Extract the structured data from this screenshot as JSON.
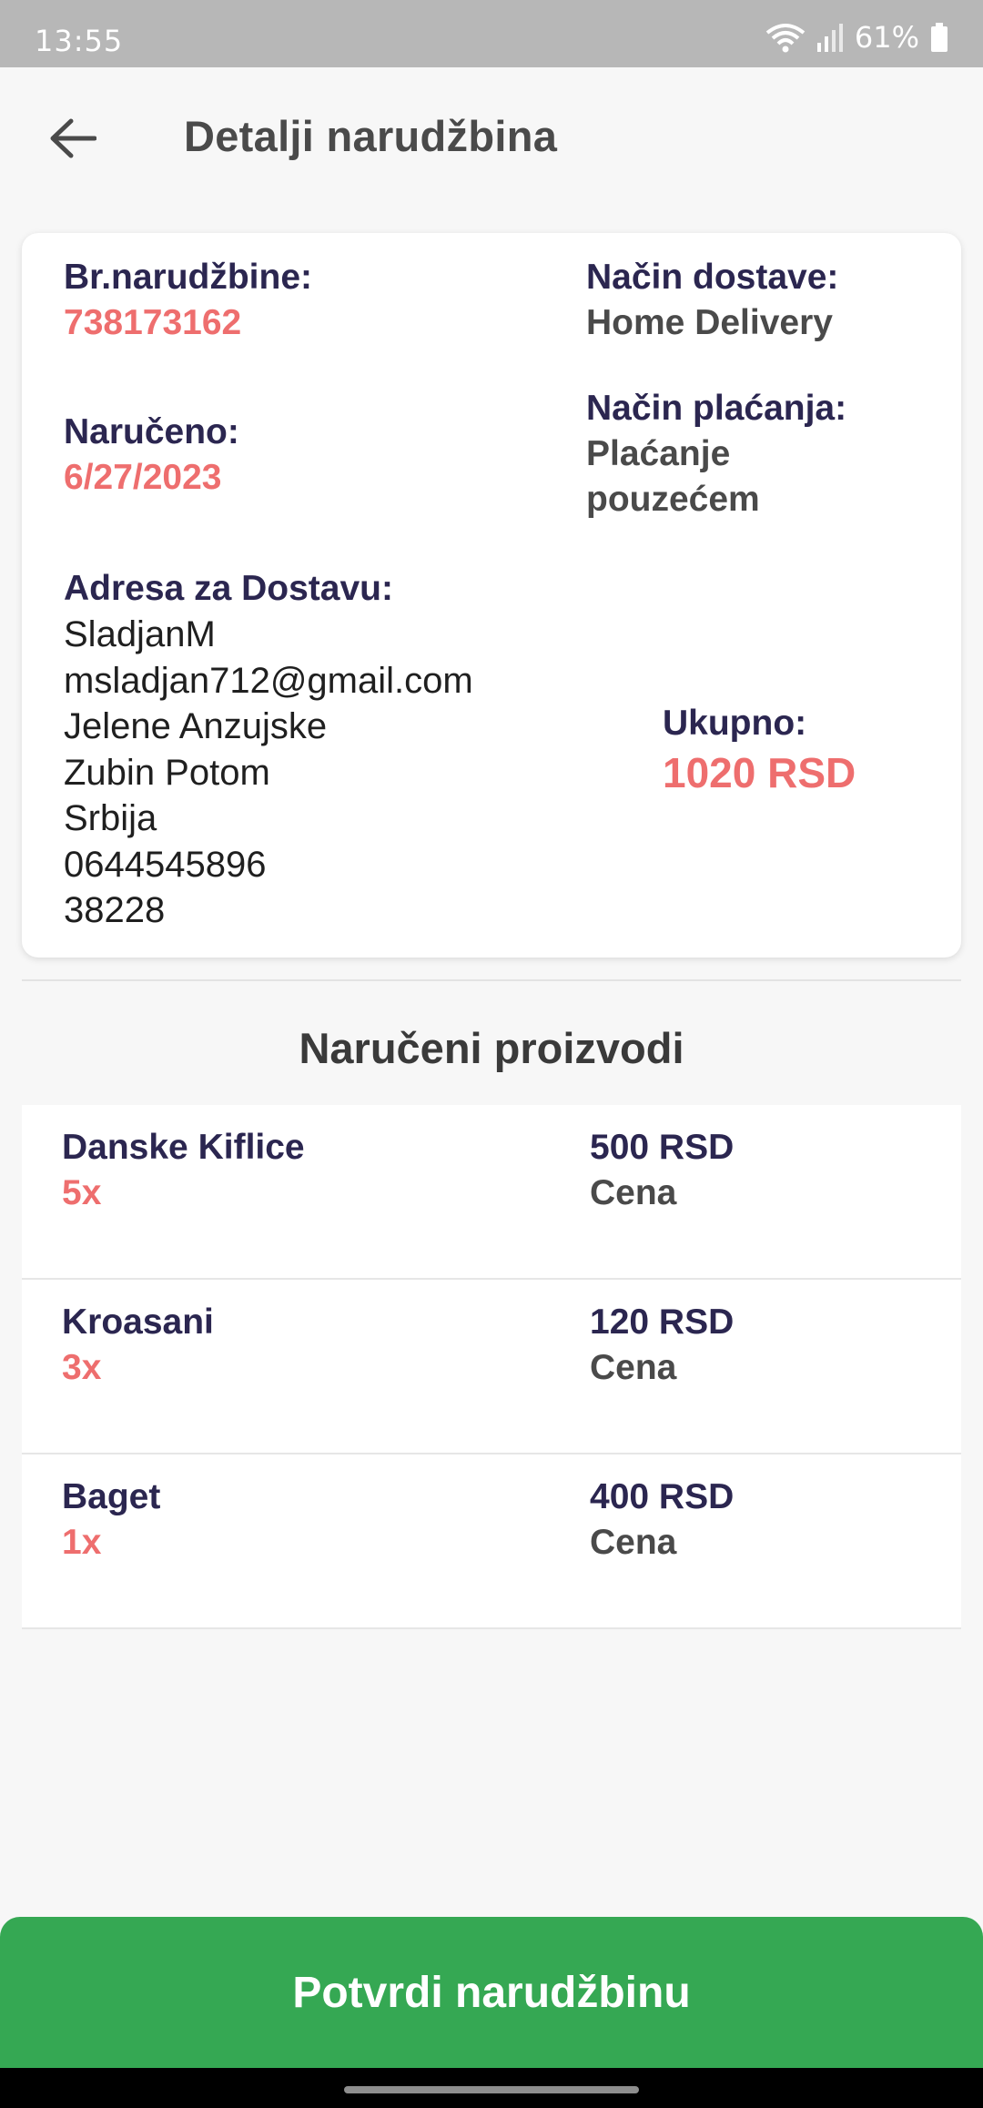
{
  "status_bar": {
    "time": "13:55",
    "battery": "61%"
  },
  "header": {
    "title": "Detalji narudžbina"
  },
  "order": {
    "number_label": "Br.narudžbine:",
    "number_value": "738173162",
    "delivery_method_label": "Način dostave:",
    "delivery_method_value": "Home Delivery",
    "ordered_label": "Naručeno:",
    "ordered_value": "6/27/2023",
    "payment_method_label": "Način plaćanja:",
    "payment_method_value_line1": "Plaćanje",
    "payment_method_value_line2": "pouzećem",
    "address_label": "Adresa za Dostavu:",
    "address_lines": [
      "SladjanM",
      "msladjan712@gmail.com",
      "Jelene Anzujske",
      "Zubin Potom",
      "Srbija",
      "0644545896",
      "38228"
    ],
    "total_label": "Ukupno:",
    "total_value": "1020 RSD"
  },
  "products_section": {
    "title": "Naručeni proizvodi",
    "items": [
      {
        "name": "Danske Kiflice",
        "qty": "5x",
        "price": "500 RSD",
        "price_label": "Cena"
      },
      {
        "name": "Kroasani",
        "qty": "3x",
        "price": "120 RSD",
        "price_label": "Cena"
      },
      {
        "name": "Baget",
        "qty": "1x",
        "price": "400 RSD",
        "price_label": "Cena"
      }
    ]
  },
  "actions": {
    "confirm_label": "Potvrdi narudžbinu"
  },
  "colors": {
    "accent_red": "#ee6e6e",
    "label_navy": "#2b2650",
    "confirm_green": "#35a853"
  }
}
